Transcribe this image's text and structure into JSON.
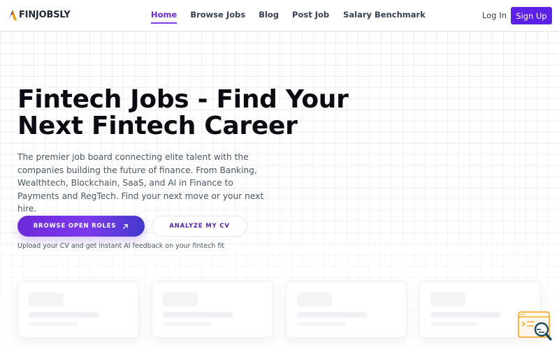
{
  "brand": {
    "name": "FINJOBSLY",
    "accent": "#6d28d9",
    "accent_dark": "#5b21e6"
  },
  "nav": {
    "items": [
      {
        "label": "Home",
        "active": true
      },
      {
        "label": "Browse Jobs",
        "active": false
      },
      {
        "label": "Blog",
        "active": false
      },
      {
        "label": "Post Job",
        "active": false
      },
      {
        "label": "Salary Benchmark",
        "active": false
      }
    ]
  },
  "auth": {
    "login_label": "Log In",
    "signup_label": "Sign Up"
  },
  "hero": {
    "title_line1": "Fintech Jobs - Find Your",
    "title_line2": "Next Fintech Career",
    "subtitle": "The premier job board connecting elite talent with the companies building the future of finance. From Banking, Wealthtech, Blockchain, SaaS, and AI in Finance to Payments and RegTech. Find your next move or your next hire.",
    "primary_cta": "BROWSE OPEN ROLES",
    "secondary_cta": "ANALYZE MY CV",
    "hint": "Upload your CV and get instant AI feedback on your fintech fit"
  },
  "icons": {
    "logo": "finjobsly-logo-icon",
    "cta_arrow": "arrow-up-right-icon",
    "widget": "cv-search-icon"
  }
}
